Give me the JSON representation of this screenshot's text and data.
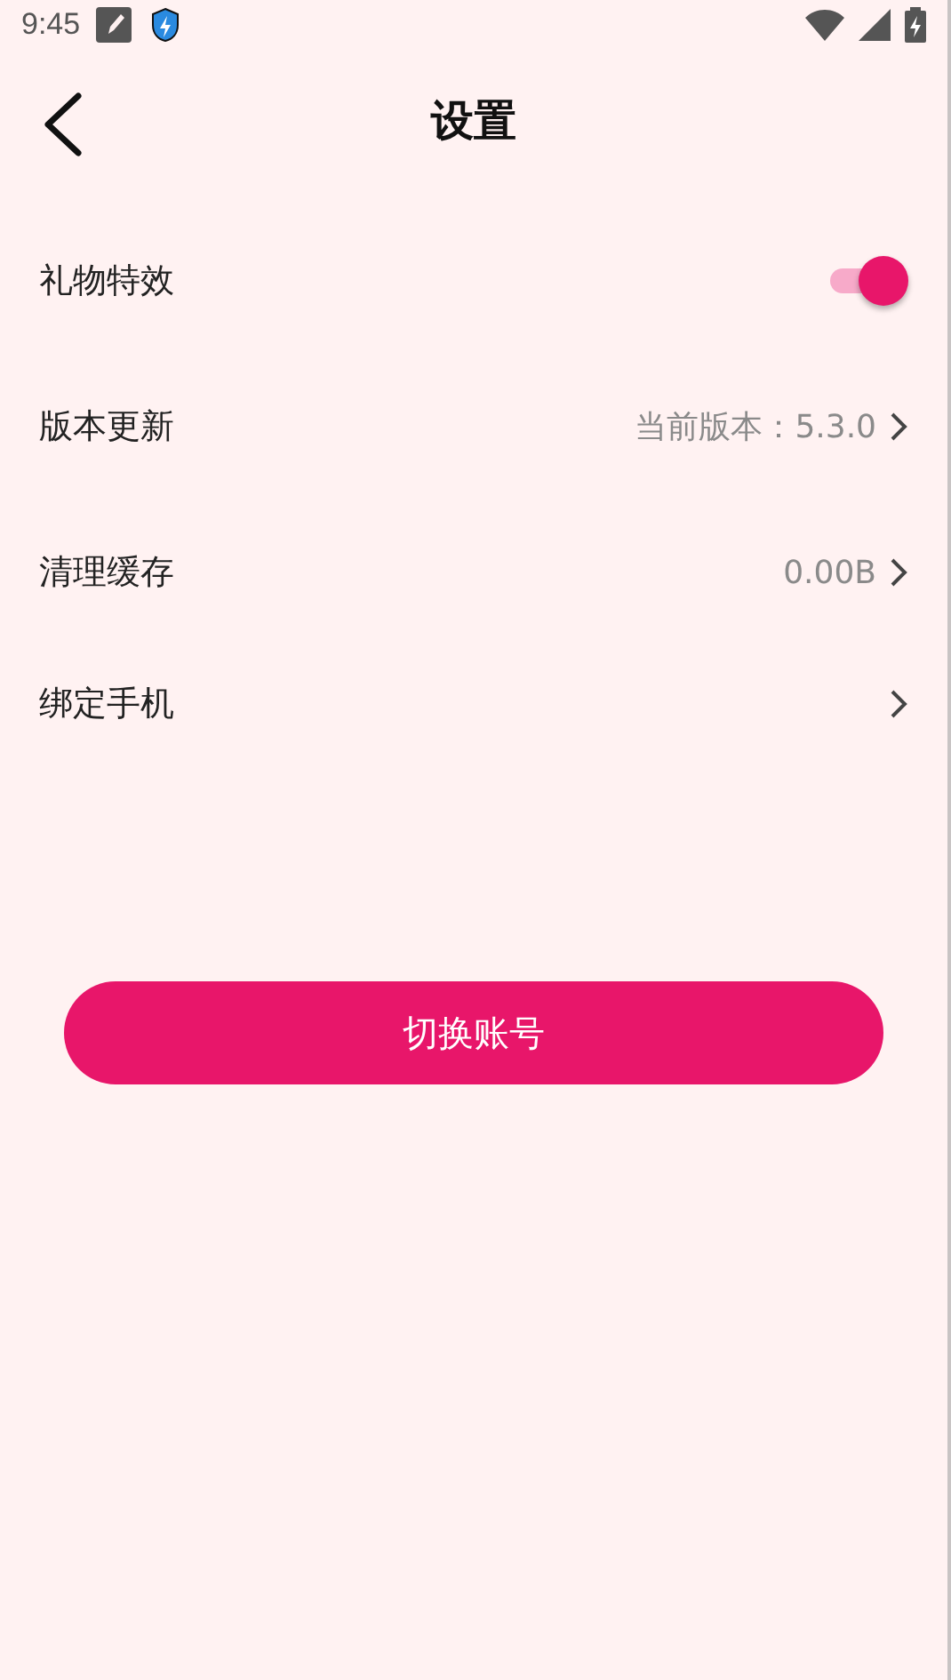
{
  "status_bar": {
    "time": "9:45"
  },
  "header": {
    "title": "设置"
  },
  "rows": [
    {
      "kind": "toggle",
      "label": "礼物特效",
      "on": true
    },
    {
      "kind": "link",
      "label": "版本更新",
      "value": "当前版本：5.3.0"
    },
    {
      "kind": "link",
      "label": "清理缓存",
      "value": "0.00B"
    },
    {
      "kind": "link",
      "label": "绑定手机"
    }
  ],
  "button": {
    "label": "切换账号"
  }
}
